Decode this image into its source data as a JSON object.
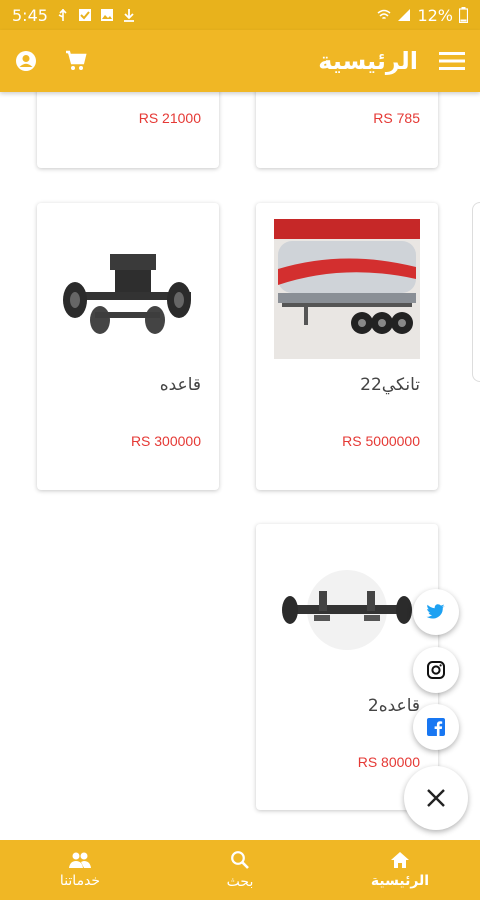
{
  "status_bar": {
    "time": "5:45",
    "battery": "12%"
  },
  "app_bar": {
    "title": "الرئيسية"
  },
  "products": [
    {
      "name": "",
      "price": "RS 21000"
    },
    {
      "name": "",
      "price": "RS 785"
    },
    {
      "name": "قاعده",
      "price": "RS 300000"
    },
    {
      "name": "تانكي22",
      "price": "RS 5000000"
    },
    {
      "name": "قاعده2",
      "price": "RS 80000"
    }
  ],
  "bottom_nav": {
    "home": "الرئيسية",
    "search": "بحث",
    "services": "خدماتنا"
  },
  "colors": {
    "primary": "#f0b725",
    "price": "#e53935",
    "twitter": "#1da1f2",
    "facebook": "#1877f2"
  },
  "icons": [
    "menu-icon",
    "cart-icon",
    "account-icon",
    "twitter-icon",
    "instagram-icon",
    "facebook-icon",
    "close-icon",
    "home-icon",
    "search-icon",
    "group-icon"
  ]
}
